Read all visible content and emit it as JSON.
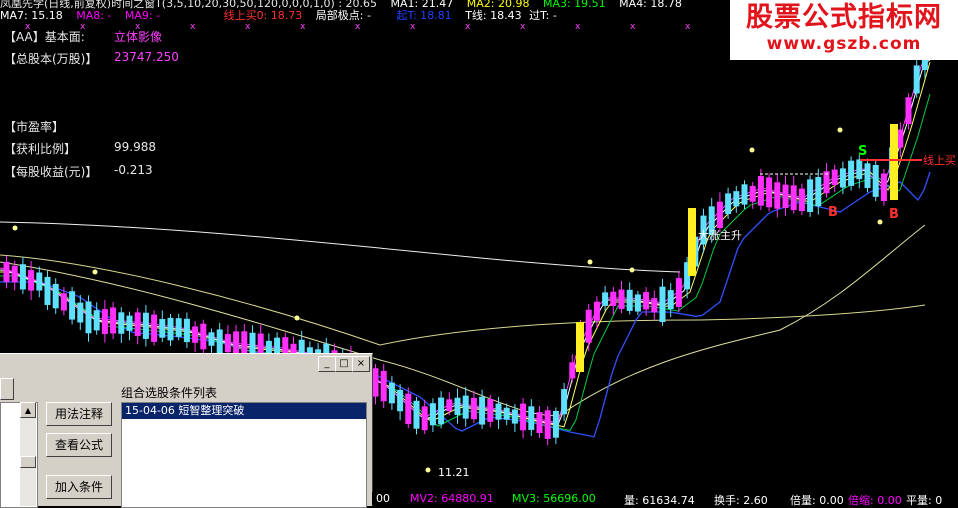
{
  "header": {
    "line1": [
      {
        "text": "凤凰先学(日线,前复权)时间之窗T(3,5,10,20,30,50,120,0,0,0,1,0) : 20.65",
        "color": "#e6e6e6"
      },
      {
        "text": "MA1: 21.47",
        "color": "#ffffff"
      },
      {
        "text": "MA2: 20.98",
        "color": "#ffff00"
      },
      {
        "text": "MA3: 19.51",
        "color": "#00ff00"
      },
      {
        "text": "MA4: 18.78",
        "color": "#ffffff"
      }
    ],
    "line2": [
      {
        "text": "MA7: 15.18",
        "color": "#ffffff"
      },
      {
        "text": "MA8: -",
        "color": "#ff00ff"
      },
      {
        "text": "MA9: -",
        "color": "#ff00ff"
      },
      {
        "text": "线上买0: 18.73",
        "color": "#ff3030"
      },
      {
        "text": "局部极点: -",
        "color": "#ffffff"
      },
      {
        "text": "起T: 18.81",
        "color": "#2040ff"
      },
      {
        "text": "T线: 18.43",
        "color": "#ffffff"
      },
      {
        "text": "过T: -",
        "color": "#ffffff"
      }
    ]
  },
  "fundamentals": {
    "aa_label": "【AA】基本面:",
    "aa_value": "立体影像",
    "total_shares_label": "【总股本(万股)】",
    "total_shares_value": "23747.250",
    "pe_label": "【市盈率】",
    "profit_ratio_label": "【获利比例】",
    "profit_ratio_value": "99.988",
    "eps_label": "【每股收益(元)】",
    "eps_value": "-0.213"
  },
  "annotations": {
    "low_price": "11.21",
    "trend_text": "大涨主升",
    "line_up_text": "线上买",
    "sell_mark": "S",
    "buy_mark_1": "B",
    "buy_mark_2": "B"
  },
  "dialog": {
    "list_title": "组合选股条件列表",
    "list_items": [
      "15-04-06 短智整理突破"
    ],
    "btn_usage": "用法注释",
    "btn_formula": "查看公式",
    "btn_add": "加入条件",
    "min_glyph": "_",
    "max_glyph": "□",
    "close_glyph": "×"
  },
  "bottom_bar": [
    {
      "text": "00",
      "color": "#ffffff"
    },
    {
      "text": "MV2: 64880.91",
      "color": "#ff00ff"
    },
    {
      "text": "MV3: 56696.00",
      "color": "#00ff00"
    },
    {
      "text": "量: 61634.74",
      "color": "#ffffff"
    },
    {
      "text": "换手: 2.60",
      "color": "#ffffff"
    },
    {
      "text": "倍量: 0.00",
      "color": "#ffffff"
    },
    {
      "text": "倍缩: 0.00",
      "color": "#ff00ff"
    },
    {
      "text": "平量: 0",
      "color": "#ffffff"
    }
  ],
  "watermark": {
    "line1": "股票公式指标网",
    "line2": "www.gszb.com"
  }
}
